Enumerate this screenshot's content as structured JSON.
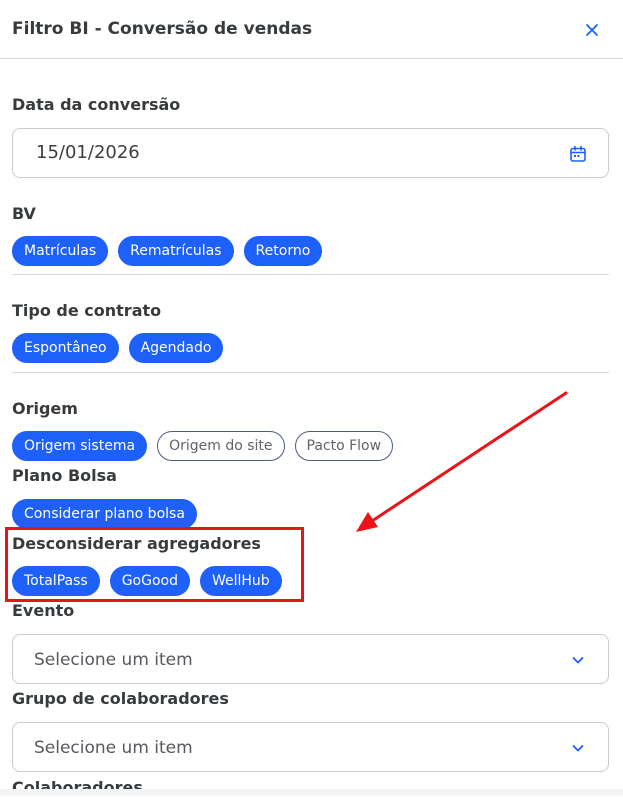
{
  "header": {
    "title": "Filtro BI - Conversão de vendas",
    "close_icon": "close-icon"
  },
  "date": {
    "label": "Data da conversão",
    "value": "15/01/2026",
    "icon": "calendar-icon"
  },
  "bv": {
    "label": "BV",
    "chips": [
      {
        "label": "Matrículas",
        "selected": true
      },
      {
        "label": "Rematrículas",
        "selected": true
      },
      {
        "label": "Retorno",
        "selected": true
      }
    ]
  },
  "contract": {
    "label": "Tipo de contrato",
    "chips": [
      {
        "label": "Espontâneo",
        "selected": true
      },
      {
        "label": "Agendado",
        "selected": true
      }
    ]
  },
  "origin": {
    "label": "Origem",
    "chips": [
      {
        "label": "Origem sistema",
        "selected": true
      },
      {
        "label": "Origem do site",
        "selected": false
      },
      {
        "label": "Pacto Flow",
        "selected": false
      }
    ]
  },
  "plan": {
    "label": "Plano Bolsa",
    "chips": [
      {
        "label": "Considerar plano bolsa",
        "selected": true
      }
    ]
  },
  "aggregators": {
    "label": "Desconsiderar agregadores",
    "chips": [
      {
        "label": "TotalPass",
        "selected": true
      },
      {
        "label": "GoGood",
        "selected": true
      },
      {
        "label": "WellHub",
        "selected": true
      }
    ]
  },
  "event": {
    "label": "Evento",
    "placeholder": "Selecione um item",
    "icon": "chevron-down-icon"
  },
  "group": {
    "label": "Grupo de colaboradores",
    "placeholder": "Selecione um item",
    "icon": "chevron-down-icon"
  },
  "collaborators": {
    "label": "Colaboradores"
  },
  "colors": {
    "accent": "#1e60fa",
    "annotation": "#e8141a",
    "text": "#383b3e",
    "border": "#c9cbd0"
  }
}
